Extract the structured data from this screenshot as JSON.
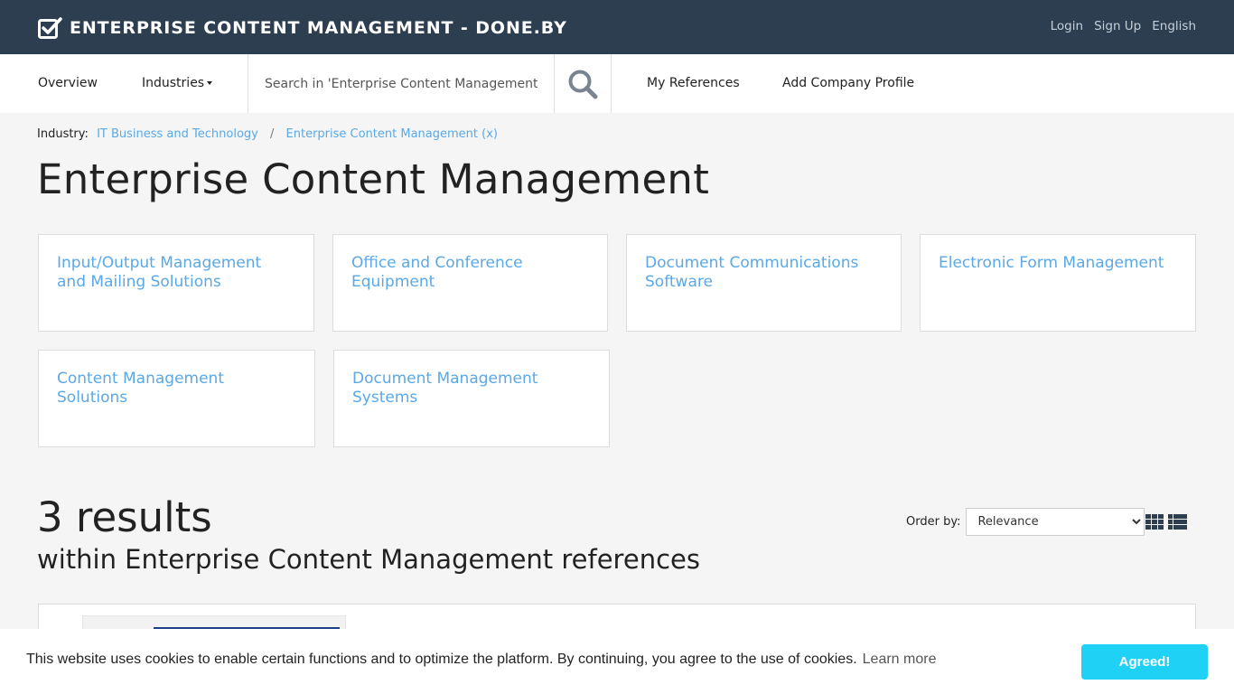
{
  "header": {
    "brand": "ENTERPRISE CONTENT MANAGEMENT - DONE.BY",
    "brand_icon": "checkbox-check-icon",
    "links": {
      "login": "Login",
      "signup": "Sign Up",
      "language": "English"
    }
  },
  "nav": {
    "overview": "Overview",
    "industries": "Industries",
    "search_placeholder": "Search in 'Enterprise Content Management'",
    "search_icon": "search-icon",
    "my_references": "My References",
    "add_company": "Add Company Profile"
  },
  "breadcrumb": {
    "label": "Industry:",
    "items": [
      "IT Business and Technology",
      "Enterprise Content Management (x)"
    ],
    "separator": "/"
  },
  "page_title": "Enterprise Content Management",
  "categories": [
    {
      "line1": "Input/Output Management",
      "line2": "and Mailing Solutions"
    },
    {
      "line1": "Office and Conference",
      "line2": "Equipment"
    },
    {
      "line1": "Document Communications",
      "line2": "Software"
    },
    {
      "line1": "Electronic Form Management",
      "line2": ""
    },
    {
      "line1": "Content Management",
      "line2": "Solutions"
    },
    {
      "line1": "Document Management",
      "line2": "Systems"
    }
  ],
  "results": {
    "count": "3 results",
    "subtitle": "within Enterprise Content Management references",
    "order_label": "Order by:",
    "order_selected": "Relevance"
  },
  "cookie": {
    "text": "This website uses cookies to enable certain functions and to optimize the platform. By continuing, you agree to the use of cookies.",
    "learn_more": "Learn more",
    "button": "Agreed!"
  },
  "colors": {
    "header_bg": "#2c3e50",
    "link": "#5aa9e6",
    "cookie_button": "#1fd2f5"
  }
}
